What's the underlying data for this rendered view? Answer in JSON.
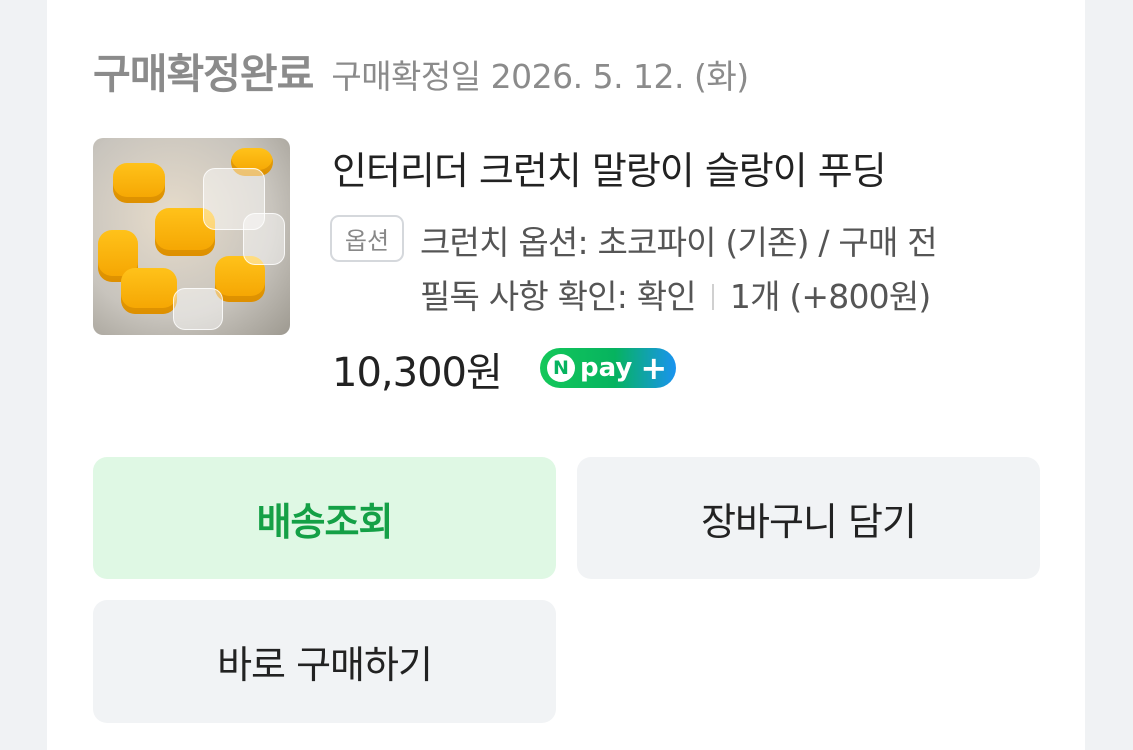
{
  "order": {
    "status": "구매확정완료",
    "confirm_date": "구매확정일 2026. 5. 12. (화)"
  },
  "product": {
    "image_icon": "product-thumbnail",
    "name": "인터리더 크런치 말랑이 슬랑이 푸딩",
    "option_badge": "옵션",
    "option_line1": "크런치 옵션: 초코파이 (기존) / 구매 전",
    "option_line2_text": "필독 사항 확인: 확인",
    "quantity": "1개 (+800원)",
    "price": "10,300원",
    "npay_logo": {
      "letter": "N",
      "word": "pay",
      "plus": "+"
    }
  },
  "actions": {
    "track": "배송조회",
    "cart": "장바구니 담기",
    "buy_now": "바로 구매하기"
  },
  "colors": {
    "accent_green": "#14a046",
    "track_bg": "#dff8e4",
    "button_bg": "#f1f3f5"
  }
}
